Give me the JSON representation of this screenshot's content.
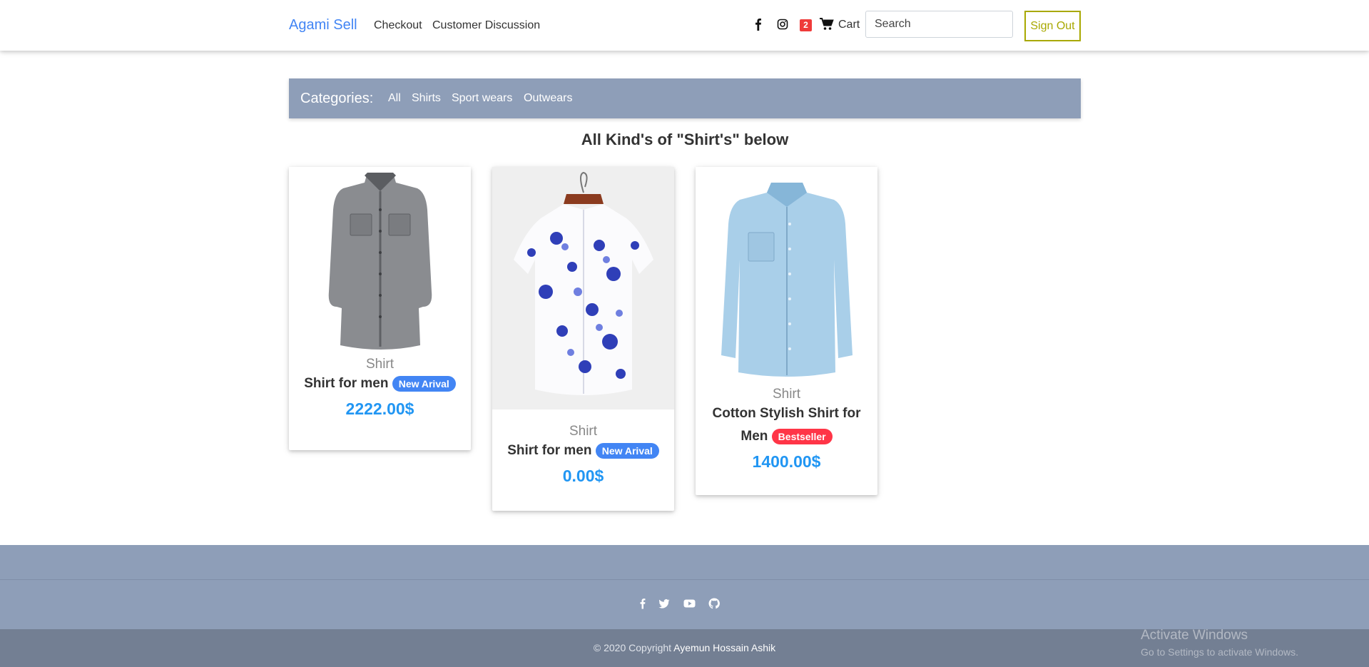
{
  "nav": {
    "brand": "Agami Sell",
    "links": [
      "Checkout",
      "Customer Discussion"
    ],
    "social_icons": [
      "facebook-icon",
      "instagram-icon"
    ],
    "cart_count": "2",
    "cart_label": "Cart",
    "search_placeholder": "Search",
    "signout_label": "Sign Out"
  },
  "categories": {
    "title": "Categories:",
    "items": [
      "All",
      "Shirts",
      "Sport wears",
      "Outwears"
    ]
  },
  "heading": "All Kind's of \"Shirt's\" below",
  "products": [
    {
      "category": "Shirt",
      "name": "Shirt for men",
      "badge": "New Arival",
      "badge_color": "#4285f4",
      "price": "2222.00$",
      "image": "grey-denim-shirt"
    },
    {
      "category": "Shirt",
      "name": "Shirt for men",
      "badge": "New Arival",
      "badge_color": "#4285f4",
      "price": "0.00$",
      "image": "floral-short-sleeve-shirt"
    },
    {
      "category": "Shirt",
      "name": "Cotton Stylish Shirt for Men",
      "badge": "Bestseller",
      "badge_color": "#ff3547",
      "price": "1400.00$",
      "image": "light-blue-denim-shirt"
    }
  ],
  "footer": {
    "social_icons": [
      "facebook-icon",
      "twitter-icon",
      "youtube-icon",
      "github-icon"
    ],
    "copyright_prefix": "© 2020 Copyright ",
    "author": "Ayemun Hossain Ashik"
  },
  "overlay": {
    "line1": "Activate Windows",
    "line2": "Go to Settings to activate Windows."
  },
  "colors": {
    "accent_blue": "#4285f4",
    "price_blue": "#2196f3",
    "category_bar": "#8e9eb8",
    "footer_bottom": "#737f93",
    "signout_olive": "#a8a800",
    "bestseller_red": "#ff3547"
  }
}
